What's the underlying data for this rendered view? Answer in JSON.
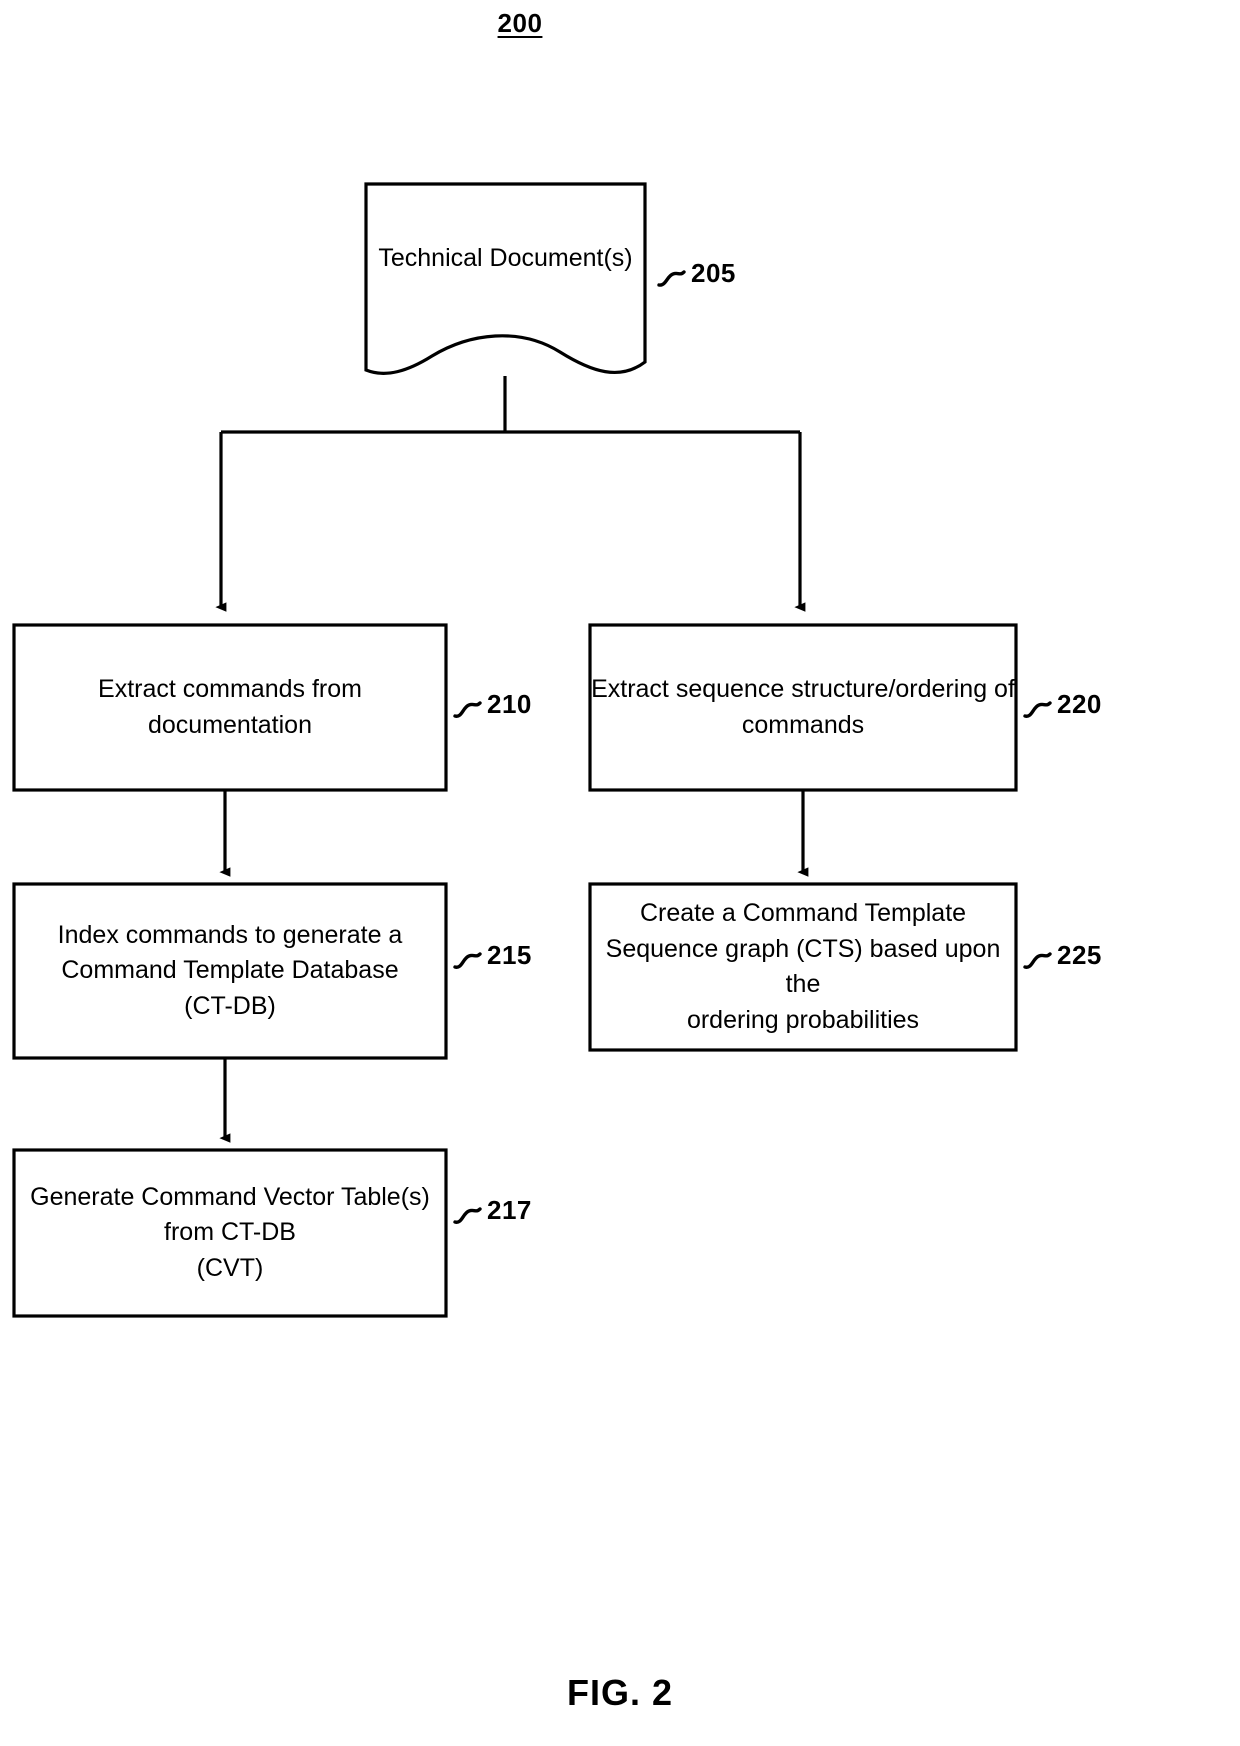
{
  "figure": {
    "number": "200",
    "caption": "FIG. 2"
  },
  "nodes": [
    {
      "id": "doc",
      "shape": "document",
      "text": "Technical Document(s)",
      "ref": "205"
    },
    {
      "id": "extract-commands",
      "shape": "rect",
      "text": "Extract commands from documentation",
      "ref": "210"
    },
    {
      "id": "index-commands",
      "shape": "rect",
      "text": "Index commands to generate a\nCommand Template Database\n(CT-DB)",
      "ref": "215"
    },
    {
      "id": "generate-cvt",
      "shape": "rect",
      "text": "Generate Command Vector Table(s)\nfrom CT-DB\n(CVT)",
      "ref": "217"
    },
    {
      "id": "extract-sequence",
      "shape": "rect",
      "text": "Extract sequence structure/ordering of\ncommands",
      "ref": "220"
    },
    {
      "id": "create-cts",
      "shape": "rect",
      "text": "Create a Command Template\nSequence graph (CTS) based upon the\nordering probabilities",
      "ref": "225"
    }
  ],
  "edges": [
    {
      "from": "doc",
      "to": "extract-commands",
      "style": "branch-left"
    },
    {
      "from": "doc",
      "to": "extract-sequence",
      "style": "branch-right"
    },
    {
      "from": "extract-commands",
      "to": "index-commands",
      "style": "straight"
    },
    {
      "from": "index-commands",
      "to": "generate-cvt",
      "style": "straight"
    },
    {
      "from": "extract-sequence",
      "to": "create-cts",
      "style": "straight"
    }
  ],
  "colors": {
    "stroke": "#000000",
    "fill": "#ffffff",
    "text": "#000000"
  }
}
